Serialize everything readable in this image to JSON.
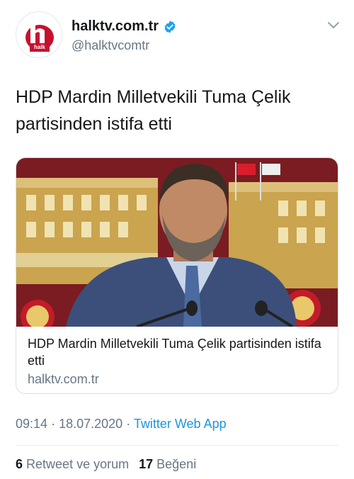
{
  "header": {
    "display_name": "halktv.com.tr",
    "handle": "@halktvcomtr",
    "avatar_text": "halk",
    "icons": {
      "verified": "verified-badge-icon",
      "menu": "chevron-down-icon"
    },
    "colors": {
      "brand_red": "#c8102e",
      "verified_blue": "#1da1f2"
    }
  },
  "tweet": {
    "text": "HDP Mardin Milletvekili Tuma Çelik partisinden istifa etti"
  },
  "card": {
    "title": "HDP Mardin Milletvekili Tuma Çelik partisinden istifa etti",
    "domain": "halktv.com.tr"
  },
  "meta": {
    "time": "09:14",
    "separator": "·",
    "date": "18.07.2020",
    "source": "Twitter Web App"
  },
  "stats": {
    "retweets_count": "6",
    "retweets_label": "Retweet ve yorum",
    "likes_count": "17",
    "likes_label": "Beğeni"
  }
}
